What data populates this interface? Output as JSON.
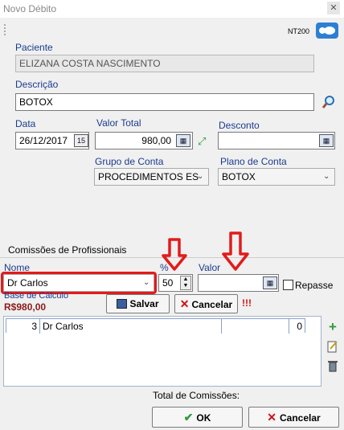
{
  "window": {
    "title": "Novo Débito",
    "close_glyph": "✕"
  },
  "toolbar": {
    "code": "NT200",
    "chat_icon": "chat-bubbles-icon"
  },
  "paciente": {
    "label": "Paciente",
    "value": "ELIZANA COSTA NASCIMENTO"
  },
  "descricao": {
    "label": "Descrição",
    "value": "BOTOX"
  },
  "data": {
    "label": "Data",
    "value": "26/12/2017"
  },
  "valor_total": {
    "label": "Valor Total",
    "value": "980,00"
  },
  "desconto": {
    "label": "Desconto",
    "value": ""
  },
  "grupo_conta": {
    "label": "Grupo de Conta",
    "value": "PROCEDIMENTOS ES"
  },
  "plano_conta": {
    "label": "Plano de Conta",
    "value": "BOTOX"
  },
  "comissoes": {
    "section_title": "Comissões de Profissionais",
    "nome_label": "Nome",
    "nome_value": "Dr Carlos",
    "percent_label": "%",
    "percent_value": "50",
    "valor_label": "Valor",
    "valor_value": "",
    "repasse_label": "Repasse",
    "repasse_checked": false,
    "base_calculo_label": "Base de Cálculo",
    "base_calculo_value": "R$980,00",
    "salvar_label": "Salvar",
    "cancelar_label": "Cancelar",
    "warning": "!!!",
    "rows": [
      {
        "num": "3",
        "name": "Dr Carlos",
        "c3": "",
        "c4": "",
        "c5": "0"
      }
    ],
    "total_label": "Total de Comissões:"
  },
  "footer": {
    "ok_label": "OK",
    "cancel_label": "Cancelar"
  },
  "colors": {
    "accent_red": "#e21b1b",
    "label_blue": "#1a3b8e",
    "base_value": "#8b1a1a"
  }
}
